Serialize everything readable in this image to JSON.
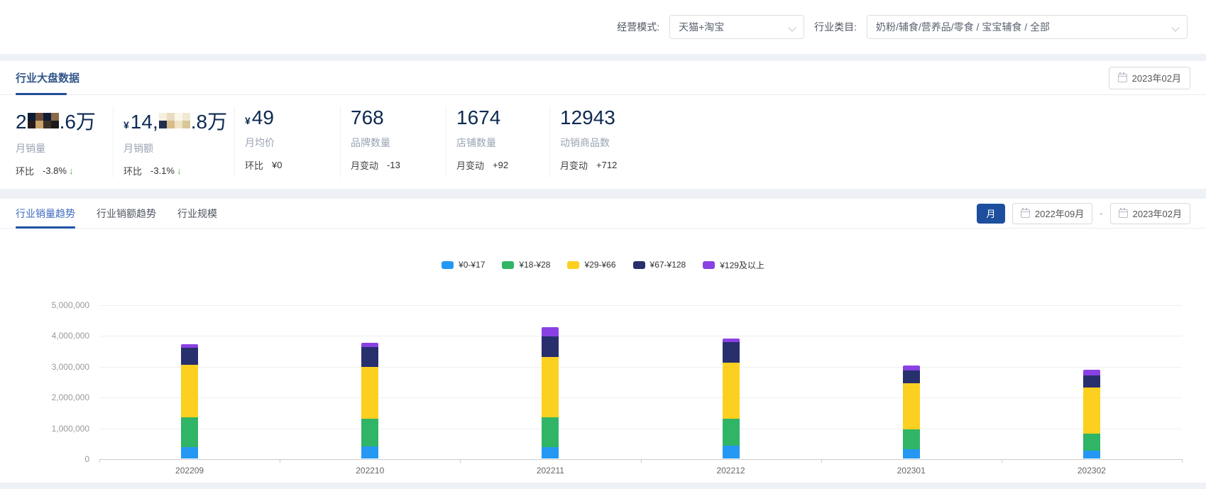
{
  "filters": {
    "mode_label": "经营模式:",
    "mode_value": "天猫+淘宝",
    "category_label": "行业类目:",
    "category_value": "奶粉/辅食/营养品/零食 / 宝宝辅食 / 全部"
  },
  "overview": {
    "title": "行业大盘数据",
    "date_picker": "2023年02月",
    "stats": [
      {
        "currency": "",
        "value_prefix": "2",
        "redacted": "dark",
        "value_suffix": ".6万",
        "label": "月销量",
        "sub_key": "环比",
        "sub_value": "-3.8%",
        "arrow": "down"
      },
      {
        "currency": "¥",
        "value_prefix": "14,",
        "redacted": "light",
        "value_suffix": ".8万",
        "label": "月销额",
        "sub_key": "环比",
        "sub_value": "-3.1%",
        "arrow": "down"
      },
      {
        "currency": "¥",
        "value_prefix": "49",
        "redacted": "",
        "value_suffix": "",
        "label": "月均价",
        "sub_key": "环比",
        "sub_value": "¥0",
        "arrow": ""
      },
      {
        "currency": "",
        "value_prefix": "768",
        "redacted": "",
        "value_suffix": "",
        "label": "品牌数量",
        "sub_key": "月变动",
        "sub_value": "-13",
        "arrow": ""
      },
      {
        "currency": "",
        "value_prefix": "1674",
        "redacted": "",
        "value_suffix": "",
        "label": "店铺数量",
        "sub_key": "月变动",
        "sub_value": "+92",
        "arrow": ""
      },
      {
        "currency": "",
        "value_prefix": "12943",
        "redacted": "",
        "value_suffix": "",
        "label": "动销商品数",
        "sub_key": "月变动",
        "sub_value": "+712",
        "arrow": ""
      }
    ]
  },
  "trend_section": {
    "tabs": [
      {
        "label": "行业销量趋势",
        "active": true
      },
      {
        "label": "行业销额趋势",
        "active": false
      },
      {
        "label": "行业规模",
        "active": false
      }
    ],
    "period_button": "月",
    "date_from": "2022年09月",
    "date_separator": "-",
    "date_to": "2023年02月"
  },
  "chart_data": {
    "type": "bar",
    "stacked": true,
    "title": "",
    "xlabel": "",
    "ylabel": "",
    "categories": [
      "202209",
      "202210",
      "202211",
      "202212",
      "202301",
      "202302"
    ],
    "series": [
      {
        "name": "¥0-¥17",
        "color": "#2498f3",
        "values": [
          380000,
          390000,
          370000,
          420000,
          300000,
          260000
        ]
      },
      {
        "name": "¥18-¥28",
        "color": "#30b566",
        "values": [
          960000,
          890000,
          960000,
          880000,
          650000,
          540000
        ]
      },
      {
        "name": "¥29-¥66",
        "color": "#fcd020",
        "values": [
          1700000,
          1690000,
          1960000,
          1800000,
          1500000,
          1500000
        ]
      },
      {
        "name": "¥67-¥128",
        "color": "#272f6d",
        "values": [
          550000,
          650000,
          670000,
          680000,
          400000,
          400000
        ]
      },
      {
        "name": "¥129及以上",
        "color": "#8a41e3",
        "values": [
          120000,
          130000,
          310000,
          120000,
          170000,
          180000
        ]
      }
    ],
    "ylim": [
      0,
      5000000
    ],
    "y_tick_labels": [
      "0",
      "1,000,000",
      "2,000,000",
      "3,000,000",
      "4,000,000",
      "5,000,000"
    ],
    "grid": true,
    "legend_position": "top-center"
  },
  "colors": {
    "accent_blue": "#1d4f9e",
    "title_blue": "#33568a",
    "stat_number": "#0e2a52",
    "positive_arrow_green": "#4cb050"
  }
}
